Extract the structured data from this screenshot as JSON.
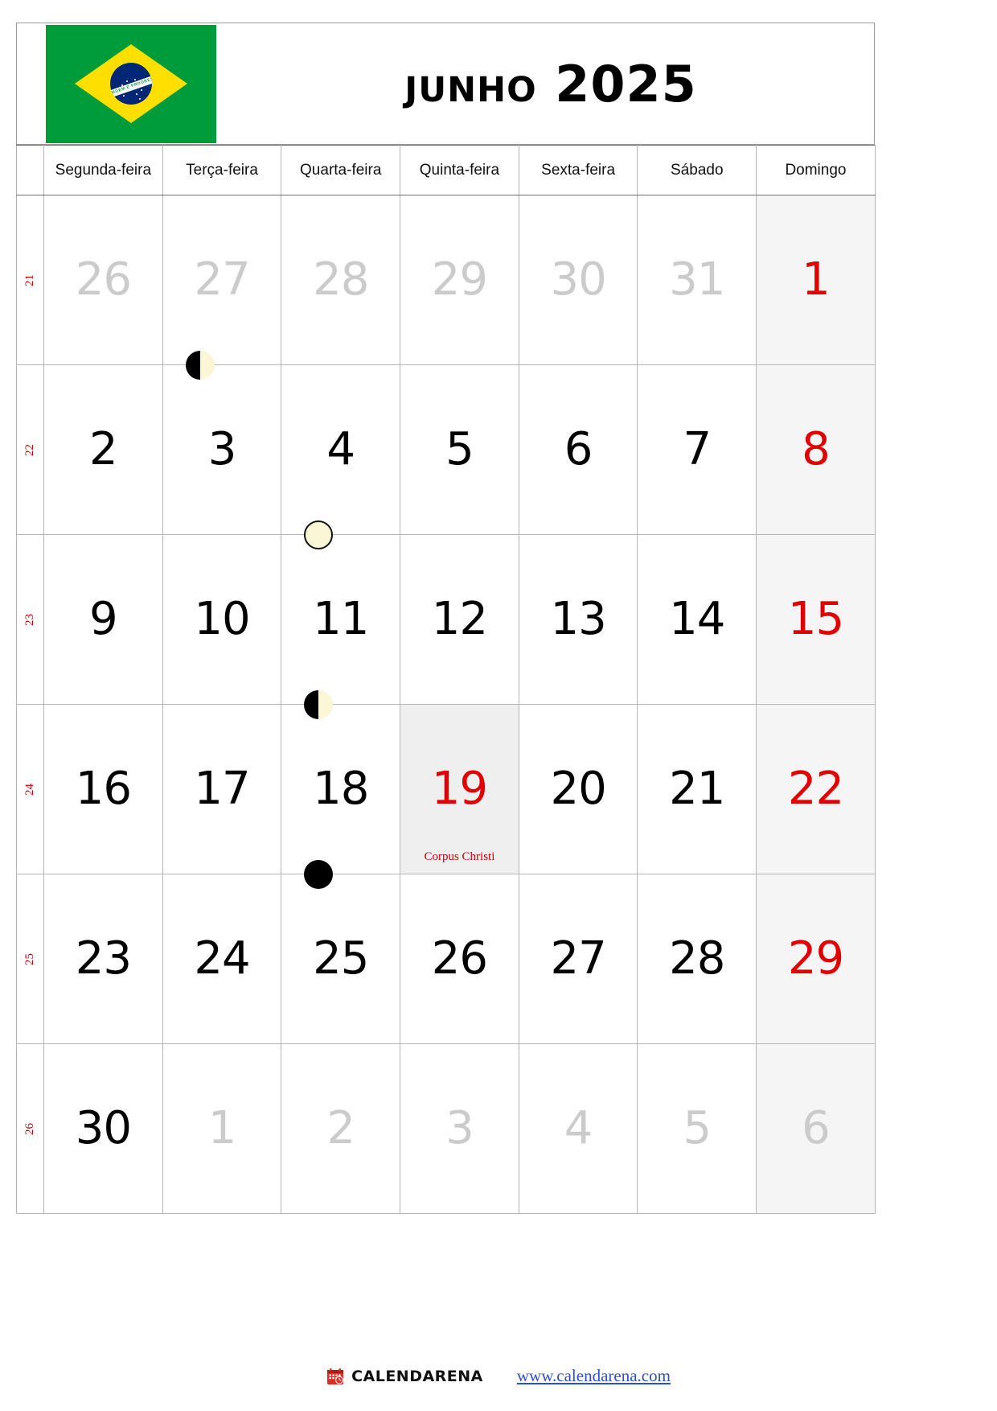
{
  "header": {
    "title": "Junho 2025",
    "flag": {
      "name": "brazil-flag",
      "green": "#009b3a",
      "yellow": "#ffdf00",
      "blue": "#002776",
      "motto": "ORDEM E PROGRESSO"
    }
  },
  "weekdays": [
    "Segunda-feira",
    "Terça-feira",
    "Quarta-feira",
    "Quinta-feira",
    "Sexta-feira",
    "Sábado",
    "Domingo"
  ],
  "week_numbers": [
    "21",
    "22",
    "23",
    "24",
    "25",
    "26"
  ],
  "colors": {
    "sunday_red": "#e00000",
    "week_number_red": "#cc0000",
    "muted_gray": "#cbcbcb",
    "sunday_bg": "#f5f5f5",
    "holiday_bg": "#efefef",
    "link_blue": "#2a4fd0"
  },
  "weeks": [
    {
      "number": "21",
      "days": [
        {
          "label": "26",
          "type": "other-month"
        },
        {
          "label": "27",
          "type": "other-month"
        },
        {
          "label": "28",
          "type": "other-month"
        },
        {
          "label": "29",
          "type": "other-month"
        },
        {
          "label": "30",
          "type": "other-month"
        },
        {
          "label": "31",
          "type": "other-month"
        },
        {
          "label": "1",
          "type": "sunday"
        }
      ]
    },
    {
      "number": "22",
      "days": [
        {
          "label": "2",
          "type": "weekday"
        },
        {
          "label": "3",
          "type": "weekday",
          "moon": "last-quarter-moon-icon"
        },
        {
          "label": "4",
          "type": "weekday"
        },
        {
          "label": "5",
          "type": "weekday"
        },
        {
          "label": "6",
          "type": "weekday"
        },
        {
          "label": "7",
          "type": "weekday"
        },
        {
          "label": "8",
          "type": "sunday"
        }
      ]
    },
    {
      "number": "23",
      "days": [
        {
          "label": "9",
          "type": "weekday"
        },
        {
          "label": "10",
          "type": "weekday"
        },
        {
          "label": "11",
          "type": "weekday",
          "moon": "full-moon-icon"
        },
        {
          "label": "12",
          "type": "weekday"
        },
        {
          "label": "13",
          "type": "weekday"
        },
        {
          "label": "14",
          "type": "weekday"
        },
        {
          "label": "15",
          "type": "sunday"
        }
      ]
    },
    {
      "number": "24",
      "days": [
        {
          "label": "16",
          "type": "weekday"
        },
        {
          "label": "17",
          "type": "weekday"
        },
        {
          "label": "18",
          "type": "weekday",
          "moon": "first-quarter-moon-icon"
        },
        {
          "label": "19",
          "type": "holiday",
          "event": "Corpus Christi"
        },
        {
          "label": "20",
          "type": "weekday"
        },
        {
          "label": "21",
          "type": "weekday"
        },
        {
          "label": "22",
          "type": "sunday"
        }
      ]
    },
    {
      "number": "25",
      "days": [
        {
          "label": "23",
          "type": "weekday"
        },
        {
          "label": "24",
          "type": "weekday"
        },
        {
          "label": "25",
          "type": "weekday",
          "moon": "new-moon-icon"
        },
        {
          "label": "26",
          "type": "weekday"
        },
        {
          "label": "27",
          "type": "weekday"
        },
        {
          "label": "28",
          "type": "weekday"
        },
        {
          "label": "29",
          "type": "sunday"
        }
      ]
    },
    {
      "number": "26",
      "days": [
        {
          "label": "30",
          "type": "weekday"
        },
        {
          "label": "1",
          "type": "other-month"
        },
        {
          "label": "2",
          "type": "other-month"
        },
        {
          "label": "3",
          "type": "other-month"
        },
        {
          "label": "4",
          "type": "other-month"
        },
        {
          "label": "5",
          "type": "other-month"
        },
        {
          "label": "6",
          "type": "other-month-sunday"
        }
      ]
    }
  ],
  "footer": {
    "brand_icon": "calendar-icon",
    "brand_name": "CALENDARENA",
    "url": "www.calendarena.com"
  }
}
